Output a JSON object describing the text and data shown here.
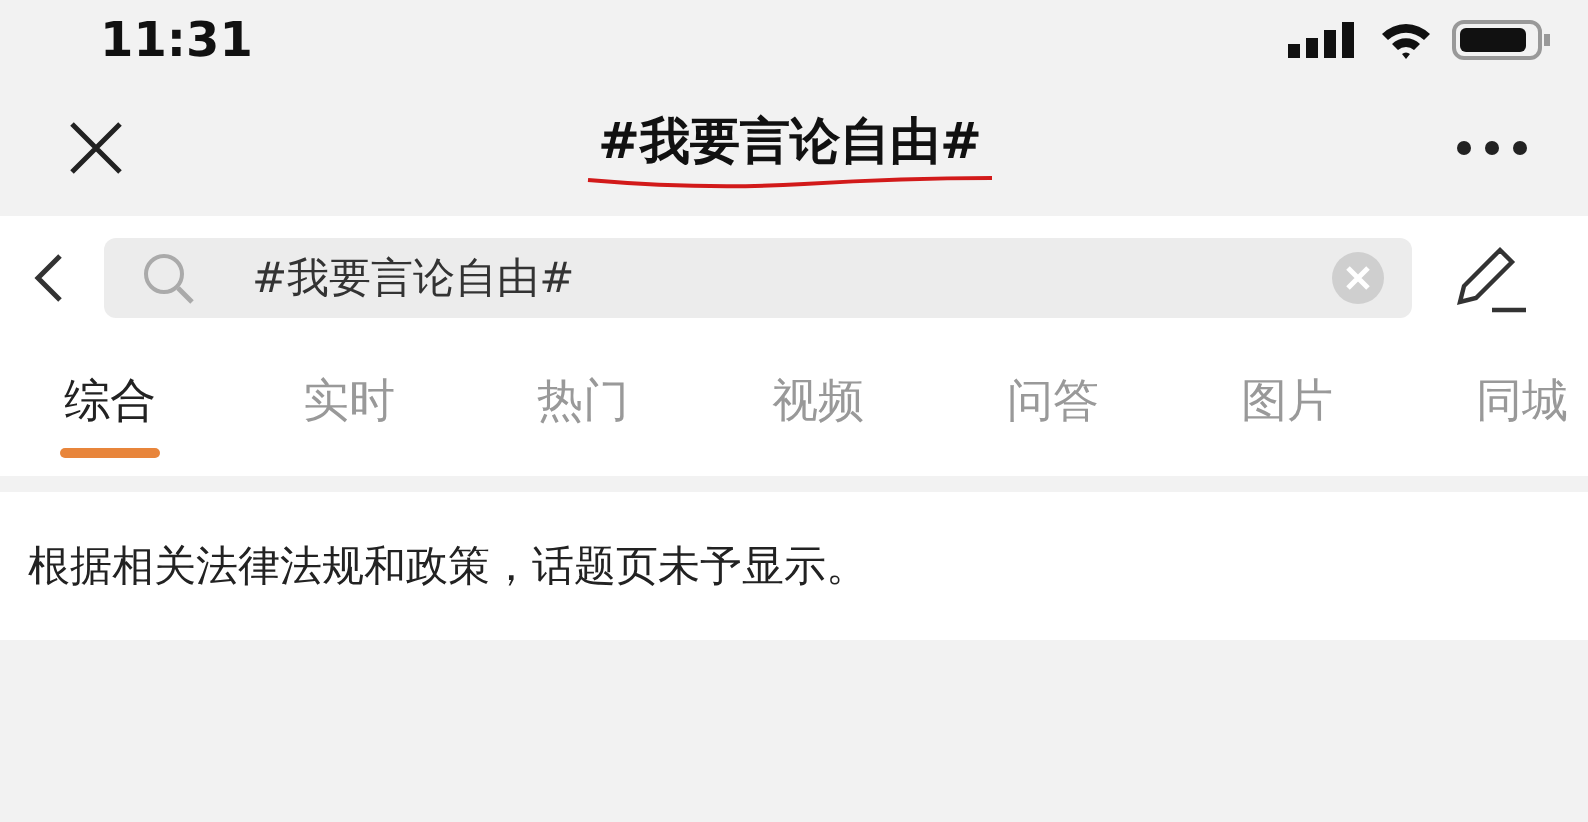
{
  "status_bar": {
    "time": "11:31"
  },
  "nav": {
    "title": "#我要言论自由#"
  },
  "search": {
    "value": "#我要言论自由#"
  },
  "tabs": [
    {
      "label": "综合",
      "selected": true
    },
    {
      "label": "实时",
      "selected": false
    },
    {
      "label": "热门",
      "selected": false
    },
    {
      "label": "视频",
      "selected": false
    },
    {
      "label": "问答",
      "selected": false
    },
    {
      "label": "图片",
      "selected": false
    },
    {
      "label": "同城",
      "selected": false
    }
  ],
  "notice": "根据相关法律法规和政策，话题页未予显示。"
}
